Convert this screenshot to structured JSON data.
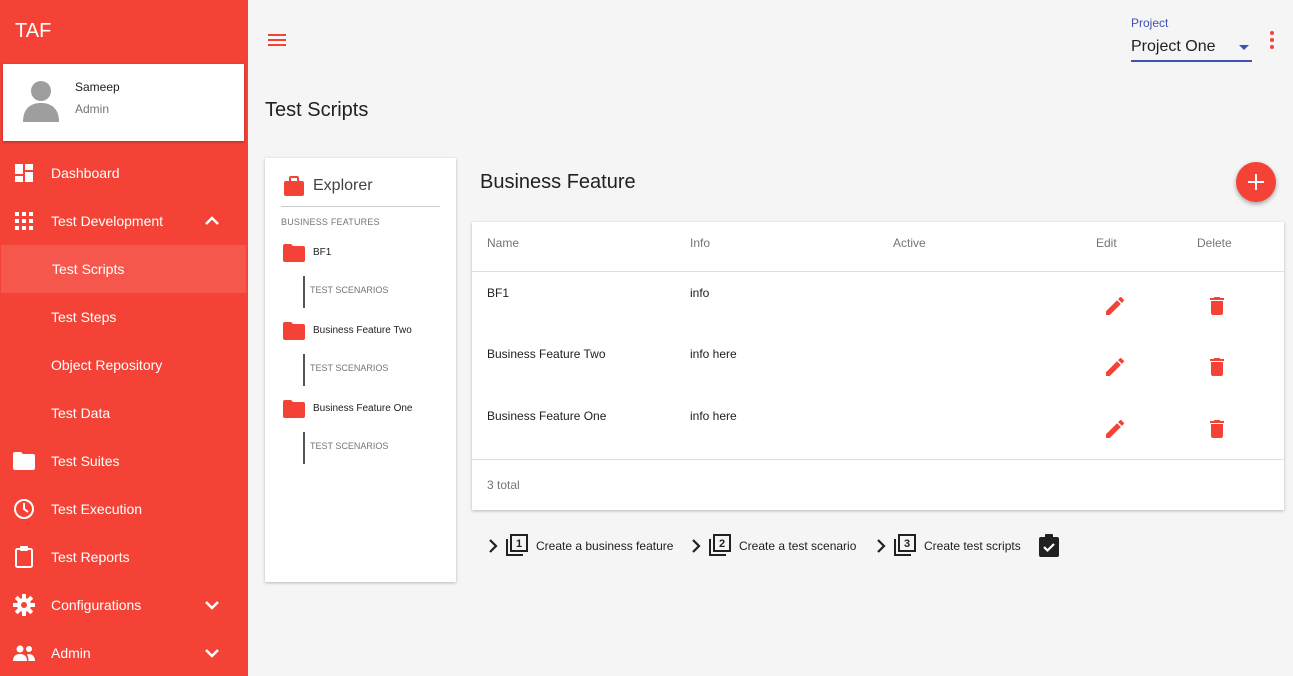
{
  "app": {
    "title": "TAF"
  },
  "user": {
    "name": "Sameep",
    "role": "Admin"
  },
  "nav": {
    "dashboard": "Dashboard",
    "test_development": "Test Development",
    "test_scripts": "Test Scripts",
    "test_steps": "Test Steps",
    "object_repository": "Object Repository",
    "test_data": "Test Data",
    "test_suites": "Test Suites",
    "test_execution": "Test Execution",
    "test_reports": "Test Reports",
    "configurations": "Configurations",
    "admin": "Admin"
  },
  "project": {
    "label": "Project",
    "value": "Project One"
  },
  "page": {
    "title": "Test Scripts"
  },
  "explorer": {
    "title": "Explorer",
    "section_label": "BUSINESS FEATURES",
    "items": [
      {
        "name": "BF1",
        "child": "TEST SCENARIOS"
      },
      {
        "name": "Business Feature Two",
        "child": "TEST SCENARIOS"
      },
      {
        "name": "Business Feature One",
        "child": "TEST SCENARIOS"
      }
    ]
  },
  "business_feature": {
    "title": "Business Feature",
    "columns": [
      "Name",
      "Info",
      "Active",
      "Edit",
      "Delete"
    ],
    "rows": [
      {
        "name": "BF1",
        "info": "info",
        "active": ""
      },
      {
        "name": "Business Feature Two",
        "info": "info here",
        "active": ""
      },
      {
        "name": "Business Feature One",
        "info": "info here",
        "active": ""
      }
    ],
    "total": "3 total"
  },
  "steps": [
    {
      "number": "1",
      "label": "Create a business feature"
    },
    {
      "number": "2",
      "label": "Create a test scenario"
    },
    {
      "number": "3",
      "label": "Create test scripts"
    }
  ],
  "colors": {
    "primary": "#f44336",
    "active_item": "#f6574c",
    "accent": "#3f51b5",
    "background": "#f5f5f5"
  },
  "icons": {
    "dashboard": "dashboard-icon",
    "test_development": "apps-grid-icon",
    "test_suites": "folder-icon",
    "test_execution": "clock-icon",
    "test_reports": "clipboard-icon",
    "configurations": "gear-icon",
    "admin": "people-icon",
    "explorer": "briefcase-icon",
    "edit": "pencil-icon",
    "delete": "trash-icon"
  }
}
